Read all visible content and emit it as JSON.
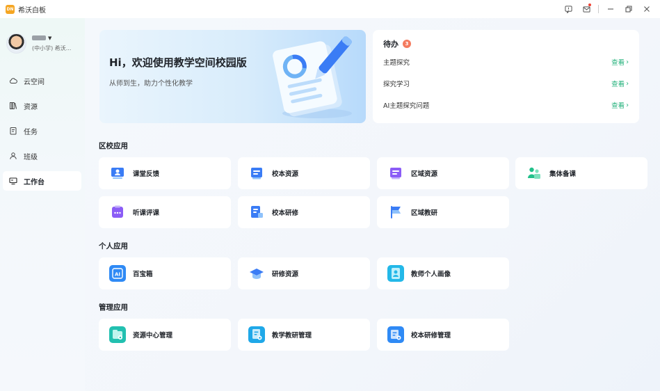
{
  "titlebar": {
    "app_logo": "DN",
    "app_title": "希沃白板",
    "icons": [
      "feedback-icon",
      "mail-icon",
      "minimize-icon",
      "restore-icon",
      "close-icon"
    ]
  },
  "profile": {
    "school": "(中小学) 希沃..."
  },
  "nav": {
    "items": [
      {
        "label": "云空间",
        "icon": "cloud-icon"
      },
      {
        "label": "资源",
        "icon": "books-icon"
      },
      {
        "label": "任务",
        "icon": "task-icon"
      },
      {
        "label": "班级",
        "icon": "class-icon"
      },
      {
        "label": "工作台",
        "icon": "monitor-icon",
        "active": true
      }
    ]
  },
  "banner": {
    "title": "Hi，欢迎使用教学空间校园版",
    "subtitle": "从师到生，助力个性化教学"
  },
  "todo": {
    "title": "待办",
    "count": "3",
    "items": [
      {
        "label": "主题探究",
        "link": "查看"
      },
      {
        "label": "探究学习",
        "link": "查看"
      },
      {
        "label": "AI主题探究问题",
        "link": "查看"
      }
    ]
  },
  "sections": {
    "school": {
      "title": "区校应用",
      "apps": [
        {
          "label": "课堂反馈",
          "icon": "classroom-feedback-icon",
          "color": "#3a7cf5"
        },
        {
          "label": "校本资源",
          "icon": "school-resource-icon",
          "color": "#3a7cf5"
        },
        {
          "label": "区域资源",
          "icon": "region-resource-icon",
          "color": "#8b5cf6"
        },
        {
          "label": "集体备课",
          "icon": "group-prepare-icon",
          "color": "#22c08a"
        },
        {
          "label": "听课评课",
          "icon": "lesson-review-icon",
          "color": "#8b5cf6"
        },
        {
          "label": "校本研修",
          "icon": "school-research-icon",
          "color": "#3a7cf5"
        },
        {
          "label": "区域教研",
          "icon": "region-research-flag-icon",
          "color": "#3a7cf5"
        }
      ]
    },
    "personal": {
      "title": "个人应用",
      "apps": [
        {
          "label": "百宝箱",
          "icon": "ai-toolbox-icon",
          "color": "#2f8af5"
        },
        {
          "label": "研修资源",
          "icon": "graduation-cap-icon",
          "color": "#3a7cf5"
        },
        {
          "label": "教师个人画像",
          "icon": "teacher-portrait-icon",
          "color": "#23b8e8"
        }
      ]
    },
    "management": {
      "title": "管理应用",
      "apps": [
        {
          "label": "资源中心管理",
          "icon": "resource-center-icon",
          "color": "#22c0b0"
        },
        {
          "label": "教学教研管理",
          "icon": "teaching-research-icon",
          "color": "#1fa8e8"
        },
        {
          "label": "校本研修管理",
          "icon": "school-research-manage-icon",
          "color": "#2f8af5"
        }
      ]
    }
  }
}
